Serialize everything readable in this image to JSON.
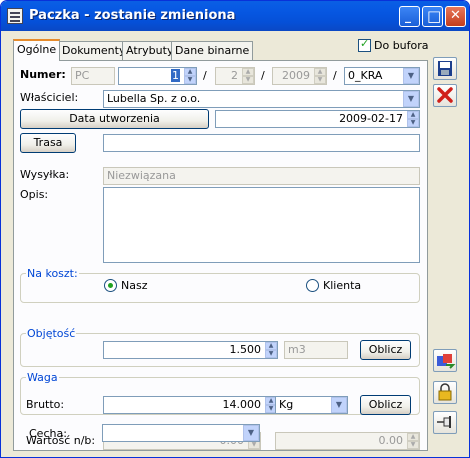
{
  "window": {
    "title": "Paczka - zostanie zmieniona"
  },
  "titlebar_buttons": {
    "minimize": "_",
    "maximize": "□",
    "close": "✕"
  },
  "tabs": [
    {
      "label": "Ogólne"
    },
    {
      "label": "Dokumenty"
    },
    {
      "label": "Atrybuty"
    },
    {
      "label": "Dane binarne"
    }
  ],
  "do_bufora": {
    "label": "Do bufora",
    "checked": true
  },
  "numer": {
    "label": "Numer:",
    "prefix": "PC",
    "number": "1",
    "sep1": "/",
    "part2": "2",
    "sep2": "/",
    "year": "2009",
    "sep3": "/",
    "series": "0_KRA"
  },
  "wlasciciel": {
    "label": "Właściciel:",
    "value": "Lubella Sp. z o.o."
  },
  "data_utworzenia": {
    "button": "Data utworzenia",
    "value": "2009-02-17"
  },
  "trasa": {
    "button": "Trasa",
    "value": ""
  },
  "wysylka": {
    "label": "Wysyłka:",
    "value": "Niezwiązana"
  },
  "opis": {
    "label": "Opis:",
    "value": ""
  },
  "na_koszt": {
    "label": "Na koszt:",
    "option1": "Nasz",
    "option2": "Klienta",
    "selected": "Nasz"
  },
  "objetosc": {
    "label": "Objętość",
    "value": "1.500",
    "unit": "m3",
    "button": "Oblicz"
  },
  "waga": {
    "label": "Waga",
    "brutto_label": "Brutto:",
    "value": "14.000",
    "unit": "Kg",
    "button": "Oblicz"
  },
  "wartosc": {
    "label": "Wartość n/b:",
    "value1": "0.00",
    "value2": "0.00"
  },
  "cecha": {
    "label": "Cecha:",
    "value": ""
  },
  "side_buttons": [
    "save-icon",
    "cancel-icon",
    "refresh-icon",
    "lock-icon",
    "pin-icon"
  ]
}
